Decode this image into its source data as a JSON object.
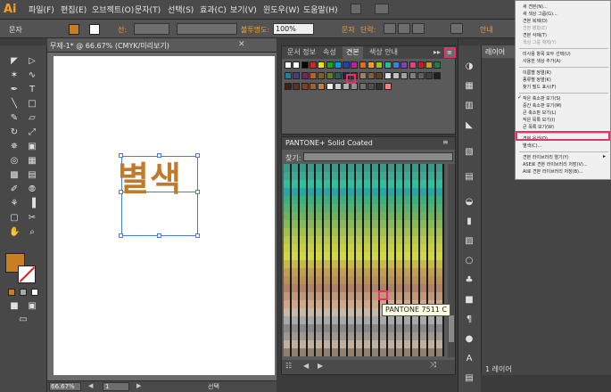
{
  "app": {
    "logo": "Ai"
  },
  "menubar": {
    "items": [
      "파일(F)",
      "편집(E)",
      "오브젝트(O)",
      "문자(T)",
      "선택(S)",
      "효과(C)",
      "보기(V)",
      "윈도우(W)",
      "도움말(H)"
    ]
  },
  "control": {
    "label_type": "문자",
    "stroke_label": "선:",
    "opacity_label": "불투명도:",
    "opacity_value": "100%",
    "char_label": "문자",
    "para_label": "단락:",
    "extra": "안내"
  },
  "document": {
    "tab_title": "무제-1* @ 66.67% (CMYK/미리보기)",
    "art_text": "별색"
  },
  "status": {
    "zoom": "66.67%",
    "page": "1",
    "tool": "선택"
  },
  "swatches_panel": {
    "tabs": [
      "문서 정보",
      "속성",
      "견본",
      "색상 안내"
    ],
    "active_tab": "견본"
  },
  "pantone_panel": {
    "title": "PANTONE+ Solid Coated",
    "search_label": "찾기:",
    "tooltip": "PANTONE 7511 C"
  },
  "layers": {
    "title": "레이어",
    "footer": "1 레이어"
  },
  "dropdown": {
    "items": [
      {
        "label": "새 견본(N)...",
        "disabled": false
      },
      {
        "label": "새 색상 그룹(G)...",
        "disabled": false
      },
      {
        "label": "견본 복제(D)",
        "disabled": false
      },
      {
        "label": "견본 병합(E)",
        "disabled": true
      },
      {
        "label": "견본 삭제(T)",
        "disabled": false
      },
      {
        "label": "색상 그룹 해제(Y)",
        "disabled": true
      },
      {
        "label": "",
        "sep": true
      },
      {
        "label": "미사용 항목 모두 선택(U)",
        "disabled": false
      },
      {
        "label": "사용한 색상 추가(A)",
        "disabled": false
      },
      {
        "label": "",
        "sep": true
      },
      {
        "label": "이름별 정렬(R)",
        "disabled": false
      },
      {
        "label": "종류별 정렬(K)",
        "disabled": false
      },
      {
        "label": "찾기 필드 표시(F)",
        "disabled": false
      },
      {
        "label": "",
        "sep": true
      },
      {
        "label": "작은 축소판 보기(S)",
        "disabled": false,
        "checked": true
      },
      {
        "label": "중간 축소판 보기(M)",
        "disabled": false
      },
      {
        "label": "큰 축소판 보기(L)",
        "disabled": false
      },
      {
        "label": "작은 목록 보기(I)",
        "disabled": false
      },
      {
        "label": "큰 목록 보기(W)",
        "disabled": false
      },
      {
        "label": "",
        "sep": true
      },
      {
        "label": "견본 옵션(O)...",
        "disabled": false,
        "highlight": true
      },
      {
        "label": "별색(C)...",
        "disabled": false
      },
      {
        "label": "",
        "sep": true
      },
      {
        "label": "견본 라이브러리 열기(Y)",
        "disabled": false,
        "submenu": true
      },
      {
        "label": "ASE로 견본 라이브러리 저장(V)...",
        "disabled": false
      },
      {
        "label": "AI로 견본 라이브러리 저장(B)...",
        "disabled": false
      }
    ]
  },
  "colors": {
    "accent_highlight": "#e8306a",
    "art_fill": "#c07a2a",
    "selection": "#4a7bdc"
  }
}
